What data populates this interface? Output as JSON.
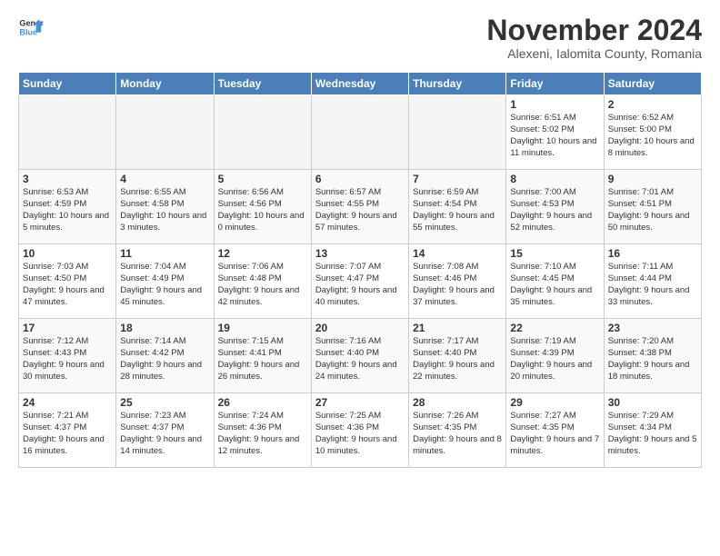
{
  "logo": {
    "line1": "General",
    "line2": "Blue"
  },
  "title": "November 2024",
  "subtitle": "Alexeni, Ialomita County, Romania",
  "days_of_week": [
    "Sunday",
    "Monday",
    "Tuesday",
    "Wednesday",
    "Thursday",
    "Friday",
    "Saturday"
  ],
  "weeks": [
    [
      {
        "day": "",
        "info": ""
      },
      {
        "day": "",
        "info": ""
      },
      {
        "day": "",
        "info": ""
      },
      {
        "day": "",
        "info": ""
      },
      {
        "day": "",
        "info": ""
      },
      {
        "day": "1",
        "info": "Sunrise: 6:51 AM\nSunset: 5:02 PM\nDaylight: 10 hours and 11 minutes."
      },
      {
        "day": "2",
        "info": "Sunrise: 6:52 AM\nSunset: 5:00 PM\nDaylight: 10 hours and 8 minutes."
      }
    ],
    [
      {
        "day": "3",
        "info": "Sunrise: 6:53 AM\nSunset: 4:59 PM\nDaylight: 10 hours and 5 minutes."
      },
      {
        "day": "4",
        "info": "Sunrise: 6:55 AM\nSunset: 4:58 PM\nDaylight: 10 hours and 3 minutes."
      },
      {
        "day": "5",
        "info": "Sunrise: 6:56 AM\nSunset: 4:56 PM\nDaylight: 10 hours and 0 minutes."
      },
      {
        "day": "6",
        "info": "Sunrise: 6:57 AM\nSunset: 4:55 PM\nDaylight: 9 hours and 57 minutes."
      },
      {
        "day": "7",
        "info": "Sunrise: 6:59 AM\nSunset: 4:54 PM\nDaylight: 9 hours and 55 minutes."
      },
      {
        "day": "8",
        "info": "Sunrise: 7:00 AM\nSunset: 4:53 PM\nDaylight: 9 hours and 52 minutes."
      },
      {
        "day": "9",
        "info": "Sunrise: 7:01 AM\nSunset: 4:51 PM\nDaylight: 9 hours and 50 minutes."
      }
    ],
    [
      {
        "day": "10",
        "info": "Sunrise: 7:03 AM\nSunset: 4:50 PM\nDaylight: 9 hours and 47 minutes."
      },
      {
        "day": "11",
        "info": "Sunrise: 7:04 AM\nSunset: 4:49 PM\nDaylight: 9 hours and 45 minutes."
      },
      {
        "day": "12",
        "info": "Sunrise: 7:06 AM\nSunset: 4:48 PM\nDaylight: 9 hours and 42 minutes."
      },
      {
        "day": "13",
        "info": "Sunrise: 7:07 AM\nSunset: 4:47 PM\nDaylight: 9 hours and 40 minutes."
      },
      {
        "day": "14",
        "info": "Sunrise: 7:08 AM\nSunset: 4:46 PM\nDaylight: 9 hours and 37 minutes."
      },
      {
        "day": "15",
        "info": "Sunrise: 7:10 AM\nSunset: 4:45 PM\nDaylight: 9 hours and 35 minutes."
      },
      {
        "day": "16",
        "info": "Sunrise: 7:11 AM\nSunset: 4:44 PM\nDaylight: 9 hours and 33 minutes."
      }
    ],
    [
      {
        "day": "17",
        "info": "Sunrise: 7:12 AM\nSunset: 4:43 PM\nDaylight: 9 hours and 30 minutes."
      },
      {
        "day": "18",
        "info": "Sunrise: 7:14 AM\nSunset: 4:42 PM\nDaylight: 9 hours and 28 minutes."
      },
      {
        "day": "19",
        "info": "Sunrise: 7:15 AM\nSunset: 4:41 PM\nDaylight: 9 hours and 26 minutes."
      },
      {
        "day": "20",
        "info": "Sunrise: 7:16 AM\nSunset: 4:40 PM\nDaylight: 9 hours and 24 minutes."
      },
      {
        "day": "21",
        "info": "Sunrise: 7:17 AM\nSunset: 4:40 PM\nDaylight: 9 hours and 22 minutes."
      },
      {
        "day": "22",
        "info": "Sunrise: 7:19 AM\nSunset: 4:39 PM\nDaylight: 9 hours and 20 minutes."
      },
      {
        "day": "23",
        "info": "Sunrise: 7:20 AM\nSunset: 4:38 PM\nDaylight: 9 hours and 18 minutes."
      }
    ],
    [
      {
        "day": "24",
        "info": "Sunrise: 7:21 AM\nSunset: 4:37 PM\nDaylight: 9 hours and 16 minutes."
      },
      {
        "day": "25",
        "info": "Sunrise: 7:23 AM\nSunset: 4:37 PM\nDaylight: 9 hours and 14 minutes."
      },
      {
        "day": "26",
        "info": "Sunrise: 7:24 AM\nSunset: 4:36 PM\nDaylight: 9 hours and 12 minutes."
      },
      {
        "day": "27",
        "info": "Sunrise: 7:25 AM\nSunset: 4:36 PM\nDaylight: 9 hours and 10 minutes."
      },
      {
        "day": "28",
        "info": "Sunrise: 7:26 AM\nSunset: 4:35 PM\nDaylight: 9 hours and 8 minutes."
      },
      {
        "day": "29",
        "info": "Sunrise: 7:27 AM\nSunset: 4:35 PM\nDaylight: 9 hours and 7 minutes."
      },
      {
        "day": "30",
        "info": "Sunrise: 7:29 AM\nSunset: 4:34 PM\nDaylight: 9 hours and 5 minutes."
      }
    ]
  ]
}
